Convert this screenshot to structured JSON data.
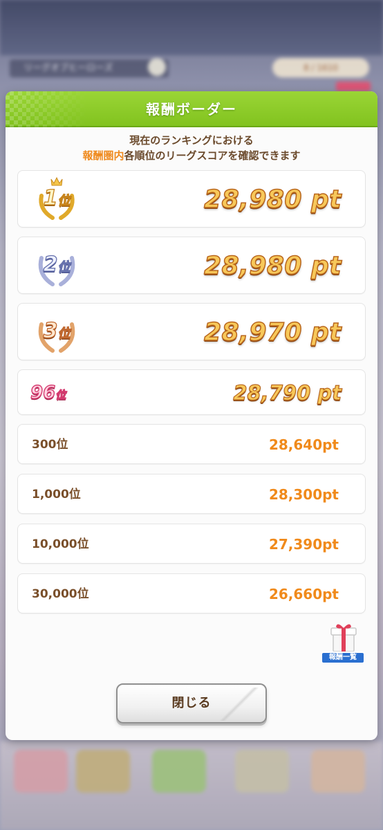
{
  "background": {
    "league_label": "リーグオブヒーローズ",
    "rank_badge": "8 / 1610"
  },
  "dialog": {
    "title": "報酬ボーダー",
    "description_line1": "現在のランキングにおける",
    "description_highlight": "報酬圏内",
    "description_rest": "各順位のリーグスコアを確認できます",
    "close_label": "閉じる",
    "gift_label": "報酬一覧"
  },
  "borders": [
    {
      "rank_num": "1",
      "rank_kanji": "位",
      "score": "28,980 pt",
      "style": "gold"
    },
    {
      "rank_num": "2",
      "rank_kanji": "位",
      "score": "28,980 pt",
      "style": "silver"
    },
    {
      "rank_num": "3",
      "rank_kanji": "位",
      "score": "28,970 pt",
      "style": "bronze"
    },
    {
      "rank_num": "96",
      "rank_kanji": "位",
      "score": "28,790 pt",
      "style": "pink"
    },
    {
      "rank": "300位",
      "score": "28,640pt",
      "style": "plain"
    },
    {
      "rank": "1,000位",
      "score": "28,300pt",
      "style": "plain"
    },
    {
      "rank": "10,000位",
      "score": "27,390pt",
      "style": "plain"
    },
    {
      "rank": "30,000位",
      "score": "26,660pt",
      "style": "plain"
    }
  ],
  "colors": {
    "header_green": "#8cc929",
    "highlight_orange": "#ef8a1e",
    "text_brown": "#6b4a2c",
    "score_orange": "#f08a1b"
  }
}
